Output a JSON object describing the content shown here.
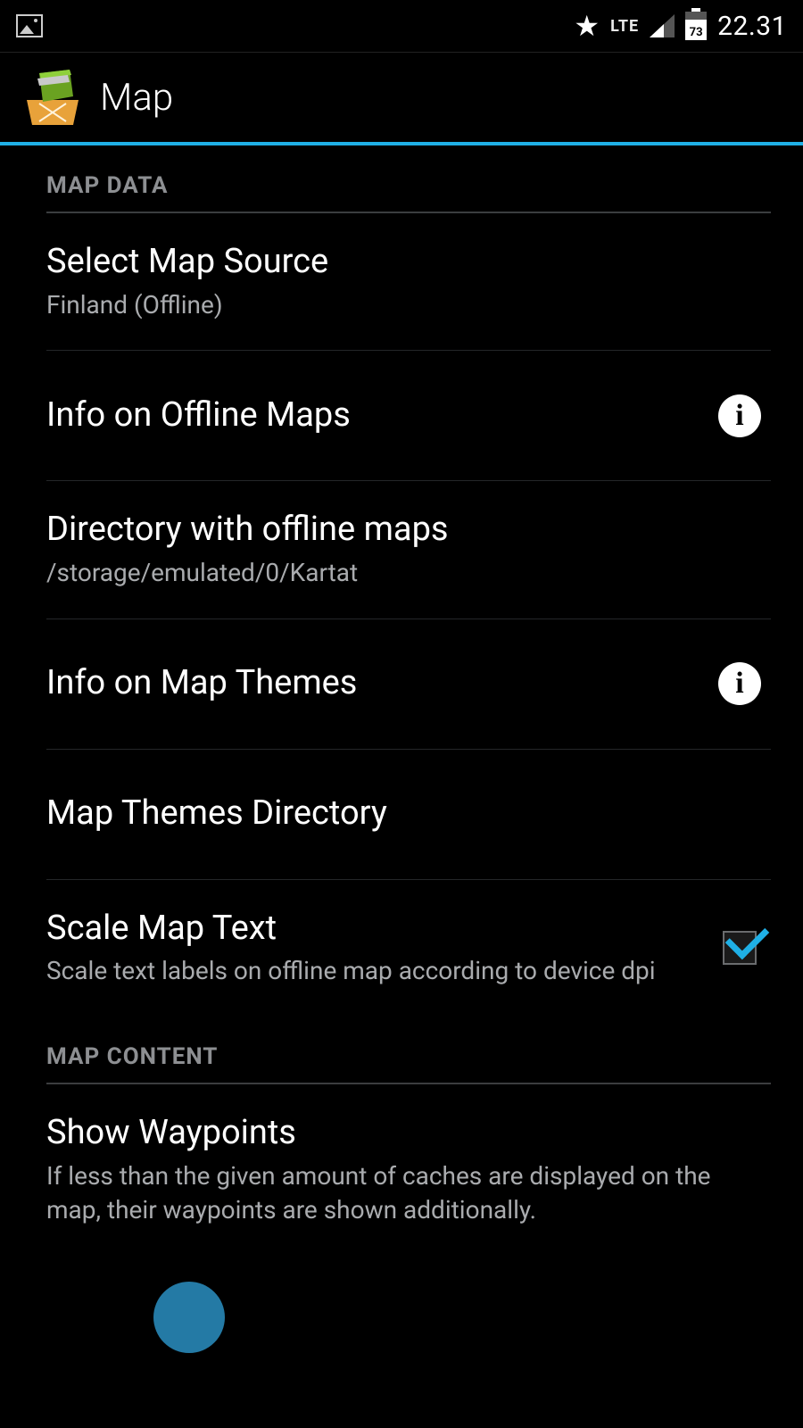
{
  "status_bar": {
    "lte": "LTE",
    "battery_pct": "73",
    "clock": "22.31"
  },
  "action_bar": {
    "title": "Map"
  },
  "sections": {
    "map_data": {
      "header": "MAP DATA",
      "select_source": {
        "title": "Select Map Source",
        "summary": "Finland (Offline)"
      },
      "info_offline": {
        "title": "Info on Offline Maps"
      },
      "offline_dir": {
        "title": "Directory with offline maps",
        "summary": "/storage/emulated/0/Kartat"
      },
      "info_themes": {
        "title": "Info on Map Themes"
      },
      "themes_dir": {
        "title": "Map Themes Directory"
      },
      "scale_text": {
        "title": "Scale Map Text",
        "summary": "Scale text labels on offline map according to device dpi",
        "checked": true
      }
    },
    "map_content": {
      "header": "MAP CONTENT",
      "show_waypoints": {
        "title": "Show Waypoints",
        "summary": "If less than the given amount of caches are displayed on the map, their waypoints are shown additionally."
      }
    }
  }
}
